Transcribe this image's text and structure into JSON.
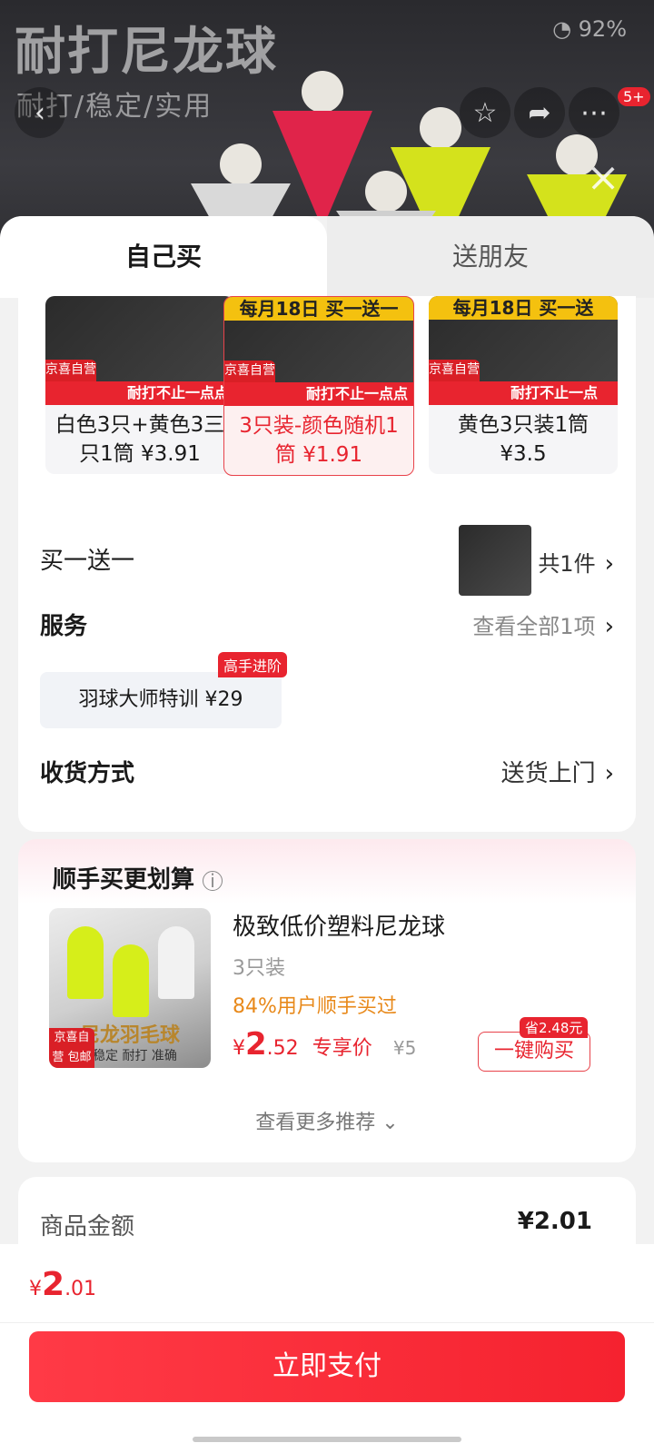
{
  "hero": {
    "title": "耐打尼龙球",
    "subtitle": "耐打/稳定/实用",
    "status": "92%",
    "notification_count": "5+"
  },
  "tabs": {
    "self": "自己买",
    "gift": "送朋友"
  },
  "variants": [
    {
      "banner": "",
      "tag": "京喜自营 包邮",
      "strip": "耐打不止一点点",
      "label": "白色3只+黄色3三只1筒 ¥3.91"
    },
    {
      "banner": "每月18日 买一送一",
      "tag": "京喜自营 包邮",
      "strip": "耐打不止一点点",
      "label": "3只装-颜色随机1筒 ¥1.91"
    },
    {
      "banner": "每月18日 买一送",
      "tag": "京喜自营 包邮",
      "strip": "耐打不止一点",
      "label": "黄色3只装1筒 ¥3.5"
    }
  ],
  "promo": {
    "label": "买一送一",
    "count": "共1件"
  },
  "service": {
    "label": "服务",
    "view_all": "查看全部1项",
    "chip": "羽球大师特训  ¥29",
    "chip_tag": "高手进阶"
  },
  "delivery": {
    "label": "收货方式",
    "value": "送货上门"
  },
  "addon": {
    "title": "顺手买更划算",
    "product_name": "极致低价塑料尼龙球",
    "spec": "3只装",
    "social": "84%用户顺手买过",
    "price_symbol": "¥",
    "price_int": "2",
    "price_dec": ".52",
    "price_tag": "专享价",
    "orig_price": "¥5",
    "save_tag": "省2.48元",
    "buy_button": "一键购买",
    "more": "查看更多推荐",
    "img_tag": "京喜自营 包邮",
    "img_text": "尼龙羽毛球",
    "img_sub": "稳定 耐打 准确"
  },
  "summary": {
    "label": "商品金额",
    "value": "¥2.01"
  },
  "footer": {
    "price_symbol": "¥",
    "price_int": "2",
    "price_dec": ".01",
    "pay_button": "立即支付"
  },
  "colors": {
    "accent": "#e8242f",
    "orange": "#e8891a"
  }
}
